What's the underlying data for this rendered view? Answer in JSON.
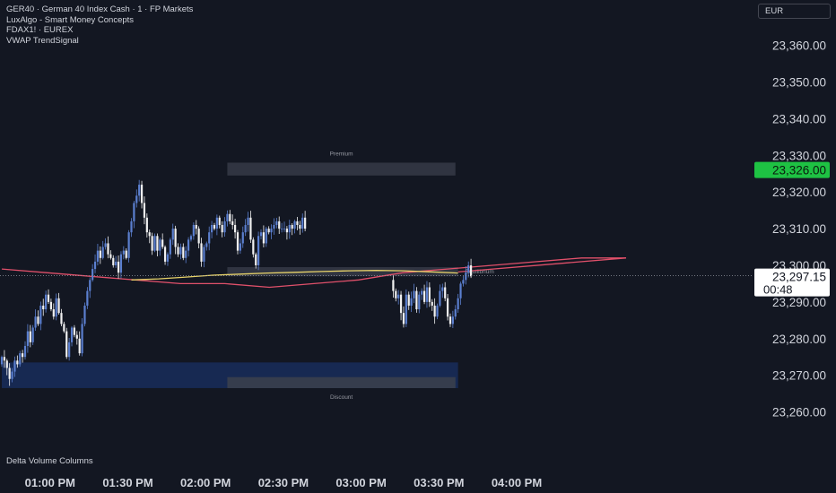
{
  "legend": {
    "line1": "GER40 · German 40 Index Cash · 1 · FP Markets",
    "line2": "LuxAlgo - Smart Money Concepts",
    "line3": "FDAX1! · EUREX",
    "line4": "VWAP TrendSignal"
  },
  "currency": "EUR",
  "bottom_pane_label": "Delta Volume Columns",
  "colors": {
    "background": "#131722",
    "up": "#5b7fcf",
    "down": "#f0f0f0",
    "vwap": "#e8d36a",
    "ma": "#e0506a",
    "zone": "#363a47",
    "discount_zone": "#172a55",
    "price_badge": "#1ec243"
  },
  "chart_data": {
    "type": "candlestick",
    "title": "GER40 · German 40 Index Cash · 1 · FP Markets",
    "x_tick_labels": [
      "01:00 PM",
      "01:30 PM",
      "02:00 PM",
      "02:30 PM",
      "03:00 PM",
      "03:30 PM",
      "04:00 PM"
    ],
    "y_tick_labels": [
      "23,360.00",
      "23,350.00",
      "23,340.00",
      "23,330.00",
      "23,320.00",
      "23,310.00",
      "23,300.00",
      "23,290.00",
      "23,280.00",
      "23,270.00",
      "23,260.00"
    ],
    "ylim": [
      23255,
      23367
    ],
    "grid": false,
    "last_price": "23,297.15",
    "countdown": "00:48",
    "premium_badge": "23,326.00",
    "zones": [
      {
        "label": "Premium",
        "start": "02:07 PM",
        "end": "03:35 PM",
        "low": 23324.5,
        "high": 23328.0
      },
      {
        "label": "Equilibrium",
        "start": "02:07 PM",
        "end": "03:36 PM",
        "low": 23297.0,
        "high": 23299.5
      },
      {
        "label": "Discount",
        "start": "02:07 PM",
        "end": "03:35 PM",
        "low": 23266.5,
        "high": 23269.5
      },
      {
        "label": "",
        "start": "12:40 PM",
        "end": "03:36 PM",
        "low": 23266.5,
        "high": 23273.5
      }
    ],
    "series": [
      {
        "name": "GER40",
        "start_time": "12:40 PM",
        "interval_minutes": 1,
        "close": [
          23275,
          23274,
          23272,
          23269,
          23271,
          23274,
          23273,
          23276,
          23275,
          23278,
          23282,
          23279,
          23283,
          23286,
          23284,
          23289,
          23288,
          23292,
          23290,
          23288,
          23286,
          23291,
          23287,
          23284,
          23282,
          23275,
          23279,
          23283,
          23281,
          23280,
          23276,
          23284,
          23289,
          23293,
          23296,
          23299,
          23301,
          23304,
          23302,
          23305,
          23306,
          23303,
          23302,
          23300,
          23301,
          23298,
          23303,
          23304,
          23302,
          23309,
          23312,
          23317,
          23319,
          23322,
          23317,
          23313,
          23309,
          23308,
          23304,
          23308,
          23304,
          23307,
          23305,
          23301,
          23303,
          23307,
          23310,
          23305,
          23303,
          23305,
          23302,
          23304,
          23307,
          23308,
          23311,
          23310,
          23306,
          23301,
          23305,
          23306,
          23309,
          23311,
          23310,
          23313,
          23311,
          23309,
          23312,
          23314,
          23312,
          23311,
          23309,
          23304,
          23306,
          23309,
          23311,
          23313,
          23307,
          23303,
          23300,
          23308,
          23309,
          23306,
          23310,
          23309,
          23310,
          23311,
          23312,
          23310,
          23310,
          23310,
          23309,
          23311,
          23310,
          23312,
          23311,
          23310,
          23313,
          23310
        ]
      },
      {
        "name": "",
        "start_time": "03:11 PM",
        "interval_minutes": 1,
        "close": [
          23293,
          23291,
          23292,
          23287,
          23284,
          23292,
          23289,
          23291,
          23293,
          23288,
          23292,
          23293,
          23290,
          23294,
          23290,
          23289,
          23286,
          23289,
          23293,
          23294,
          23291,
          23286,
          23284,
          23286,
          23288,
          23291,
          23295,
          23296,
          23298,
          23300,
          23297
        ]
      },
      {
        "name": "",
        "type": "line",
        "start_time": "12:40 PM",
        "values": [
          23299,
          23298,
          23297,
          23296,
          23295,
          23295,
          23294,
          23295,
          23296,
          23298,
          23299,
          23300,
          23301,
          23302,
          23302
        ]
      },
      {
        "name": "",
        "type": "line",
        "start_time": "01:30 PM",
        "values": [
          23296,
          23296.3,
          23296.8,
          23297.3,
          23297.6,
          23297.9,
          23298.1,
          23298.3,
          23298.5,
          23298.6,
          23298.5,
          23298.2,
          23297.9
        ]
      }
    ]
  }
}
